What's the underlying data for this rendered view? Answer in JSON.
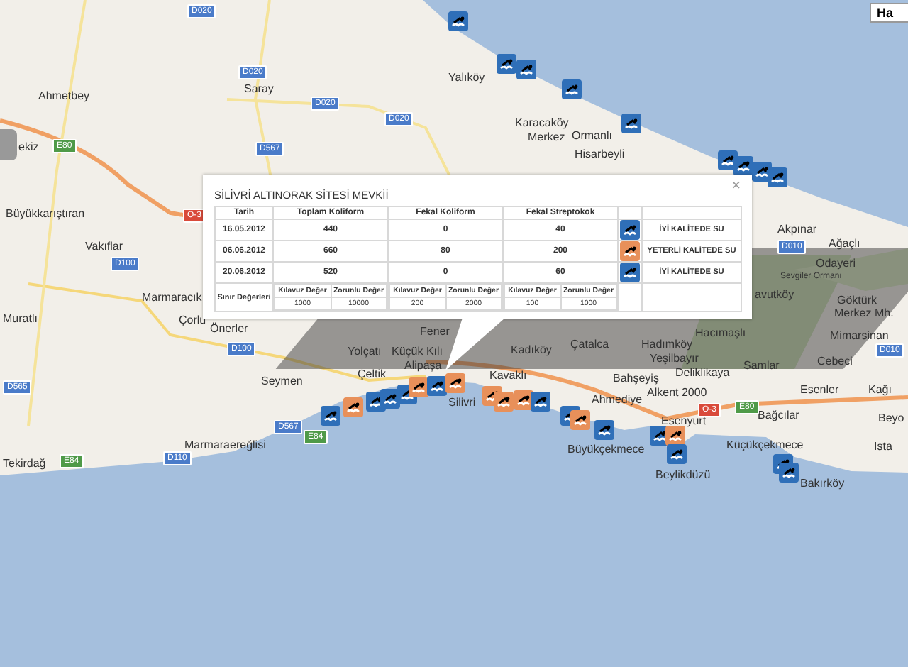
{
  "map": {
    "map_type_button": "Ha",
    "places": [
      "Yalıköy",
      "Saray",
      "Ahmetbey",
      "Karacaköy",
      "Ormanlı",
      "Merkez",
      "ekiz",
      "Hisarbeyli",
      "Büyükkarıştıran",
      "Akpınar",
      "Ağaçlı",
      "Vakıflar",
      "Odayeri",
      "Sevgiler Ormanı",
      "Marmaracık",
      "avutköy",
      "Göktürk",
      "Merkez Mh.",
      "Muratlı",
      "Çorlu",
      "Önerler",
      "Fener",
      "Hacımaşlı",
      "Mimarsinan",
      "Yolçatı",
      "Küçük Kılı",
      "Kadıköy",
      "Çatalca",
      "Hadımköy",
      "Yeşilbayır",
      "Cebeci",
      "Seymen",
      "Çeltik",
      "Alipaşa",
      "Kavaklı",
      "Bahşeyiş",
      "Deliklikaya",
      "Samlar",
      "Silivri",
      "Ahmediye",
      "Alkent 2000",
      "Esenler",
      "Kağı",
      "Esenyurt",
      "Bağcılar",
      "Beyo",
      "Marmaraereğlisi",
      "Büyükçekmece",
      "Küçükçekmece",
      "Ista",
      "Tekirdağ",
      "Beylikdüzü",
      "Bakırköy"
    ],
    "roads": [
      {
        "label": "D020",
        "color": "#4a7bc9"
      },
      {
        "label": "D020",
        "color": "#4a7bc9"
      },
      {
        "label": "D020",
        "color": "#4a7bc9"
      },
      {
        "label": "D020",
        "color": "#4a7bc9"
      },
      {
        "label": "D567",
        "color": "#4a7bc9"
      },
      {
        "label": "E80",
        "color": "#4f9a48"
      },
      {
        "label": "O-3",
        "color": "#d94a3a"
      },
      {
        "label": "D010",
        "color": "#4a7bc9"
      },
      {
        "label": "D100",
        "color": "#4a7bc9"
      },
      {
        "label": "D010",
        "color": "#4a7bc9"
      },
      {
        "label": "D565",
        "color": "#4a7bc9"
      },
      {
        "label": "D100",
        "color": "#4a7bc9"
      },
      {
        "label": "O-3",
        "color": "#d94a3a"
      },
      {
        "label": "E80",
        "color": "#4f9a48"
      },
      {
        "label": "D567",
        "color": "#4a7bc9"
      },
      {
        "label": "E84",
        "color": "#4f9a48"
      },
      {
        "label": "D110",
        "color": "#4a7bc9"
      },
      {
        "label": "E84",
        "color": "#4f9a48"
      }
    ],
    "markers": [
      {
        "color": "#2f6fb8"
      },
      {
        "color": "#2f6fb8"
      },
      {
        "color": "#2f6fb8"
      },
      {
        "color": "#2f6fb8"
      },
      {
        "color": "#2f6fb8"
      },
      {
        "color": "#2f6fb8"
      },
      {
        "color": "#2f6fb8"
      },
      {
        "color": "#2f6fb8"
      },
      {
        "color": "#2f6fb8"
      },
      {
        "color": "#2f6fb8"
      },
      {
        "color": "#e8905a"
      },
      {
        "color": "#2f6fb8"
      },
      {
        "color": "#2f6fb8"
      },
      {
        "color": "#2f6fb8"
      },
      {
        "color": "#e8905a"
      },
      {
        "color": "#2f6fb8"
      },
      {
        "color": "#e8905a"
      },
      {
        "color": "#e8905a"
      },
      {
        "color": "#e8905a"
      },
      {
        "color": "#e8905a"
      },
      {
        "color": "#2f6fb8"
      },
      {
        "color": "#2f6fb8"
      },
      {
        "color": "#e8905a"
      },
      {
        "color": "#2f6fb8"
      },
      {
        "color": "#2f6fb8"
      },
      {
        "color": "#e8905a"
      },
      {
        "color": "#2f6fb8"
      },
      {
        "color": "#2f6fb8"
      },
      {
        "color": "#2f6fb8"
      }
    ]
  },
  "popup": {
    "title": "SİLİVRİ ALTINORAK SİTESİ MEVKİİ",
    "close": "×",
    "columns": [
      "Tarih",
      "Toplam Koliform",
      "Fekal Koliform",
      "Fekal Streptokok"
    ],
    "rows": [
      {
        "date": "16.05.2012",
        "total_coliform": "440",
        "fecal_coliform": "0",
        "fecal_streptococcus": "40",
        "color": "#2f6fb8",
        "quality_label": "İYİ KALİTEDE SU"
      },
      {
        "date": "06.06.2012",
        "total_coliform": "660",
        "fecal_coliform": "80",
        "fecal_streptococcus": "200",
        "color": "#e8905a",
        "quality_label": "YETERLİ KALİTEDE SU"
      },
      {
        "date": "20.06.2012",
        "total_coliform": "520",
        "fecal_coliform": "0",
        "fecal_streptococcus": "60",
        "color": "#2f6fb8",
        "quality_label": "İYİ KALİTEDE SU"
      }
    ],
    "limits": {
      "label": "Sınır Değerleri",
      "groups": [
        {
          "guide_label": "Kılavuz Değer",
          "mandatory_label": "Zorunlu Değer",
          "guide": "1000",
          "mandatory": "10000"
        },
        {
          "guide_label": "Kılavuz Değer",
          "mandatory_label": "Zorunlu Değer",
          "guide": "200",
          "mandatory": "2000"
        },
        {
          "guide_label": "Kılavuz Değer",
          "mandatory_label": "Zorunlu Değer",
          "guide": "100",
          "mandatory": "1000"
        }
      ]
    }
  }
}
